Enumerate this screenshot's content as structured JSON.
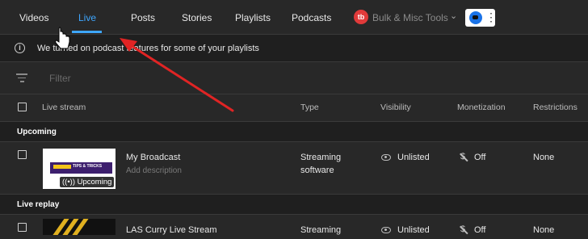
{
  "tabs": {
    "videos": "Videos",
    "live": "Live",
    "posts": "Posts",
    "stories": "Stories",
    "playlists": "Playlists",
    "podcasts": "Podcasts"
  },
  "extension": {
    "badge": "tb",
    "tools_label": "Bulk & Misc Tools",
    "chevron": "⌄",
    "menu_dots": "⋮"
  },
  "banner": {
    "icon_glyph": "i",
    "text": "We turned on podcast features for some of your playlists"
  },
  "filter": {
    "placeholder": "Filter"
  },
  "columns": {
    "live_stream": "Live stream",
    "type": "Type",
    "visibility": "Visibility",
    "monetization": "Monetization",
    "restrictions": "Restrictions"
  },
  "sections": {
    "upcoming": "Upcoming",
    "live_replay": "Live replay"
  },
  "rows": [
    {
      "title": "My Broadcast",
      "description": "Add description",
      "type_line1": "Streaming",
      "type_line2": "software",
      "visibility": "Unlisted",
      "monetization": "Off",
      "restrictions": "None",
      "thumb_badge": "((•)) Upcoming",
      "thumb_text": "TIPS & TRICKS"
    },
    {
      "title": "LAS Curry Live Stream",
      "type_line1": "Streaming",
      "visibility": "Unlisted",
      "monetization": "Off",
      "restrictions": "None"
    }
  ],
  "colors": {
    "accent": "#3ea6ff",
    "background": "#282828",
    "arrow": "#e02424"
  }
}
